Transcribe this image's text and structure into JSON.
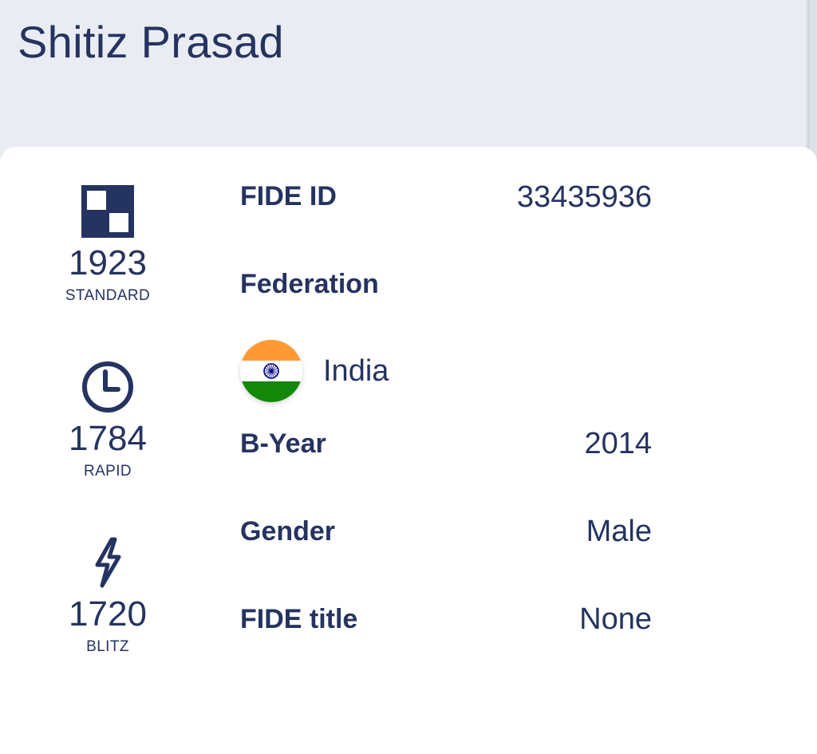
{
  "player": {
    "name": "Shitiz Prasad"
  },
  "ratings": [
    {
      "value": "1923",
      "label": "STANDARD",
      "icon": "standard-board-icon"
    },
    {
      "value": "1784",
      "label": "RAPID",
      "icon": "clock-icon"
    },
    {
      "value": "1720",
      "label": "BLITZ",
      "icon": "lightning-icon"
    }
  ],
  "details": {
    "fide_id": {
      "label": "FIDE ID",
      "value": "33435936"
    },
    "federation": {
      "label": "Federation",
      "country": "India",
      "flag_icon": "india-flag-icon"
    },
    "byear": {
      "label": "B-Year",
      "value": "2014"
    },
    "gender": {
      "label": "Gender",
      "value": "Male"
    },
    "title": {
      "label": "FIDE title",
      "value": "None"
    }
  },
  "colors": {
    "text": "#253360",
    "header_bg": "#e9ecf2",
    "card_bg": "#ffffff",
    "saffron": "#ff9933",
    "green": "#138808",
    "chakra": "#000080"
  }
}
